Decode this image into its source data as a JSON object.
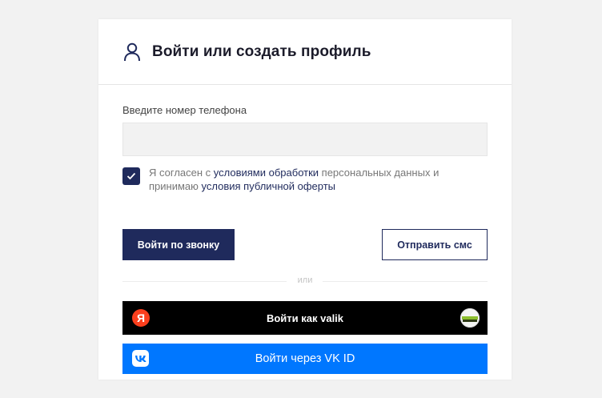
{
  "header": {
    "title": "Войти или создать профиль",
    "icon": "user-icon"
  },
  "form": {
    "phone_label": "Введите номер телефона",
    "phone_value": "",
    "phone_placeholder": ""
  },
  "consent": {
    "checked": true,
    "text_1": "Я согласен с ",
    "link_1": "условиями обработки",
    "text_2": " персональных данных и принимаю ",
    "link_2": "условия публичной оферты"
  },
  "buttons": {
    "call": "Войти по звонку",
    "sms": "Отправить смс"
  },
  "divider": {
    "label": "или"
  },
  "yandex": {
    "label": "Войти как valik",
    "logo_letter": "Я"
  },
  "vk": {
    "label": "Войти через VK ID"
  },
  "colors": {
    "primary": "#1f2a5c",
    "yandex_bg": "#000000",
    "yandex_logo": "#fc3f1d",
    "vk_bg": "#0077ff"
  }
}
